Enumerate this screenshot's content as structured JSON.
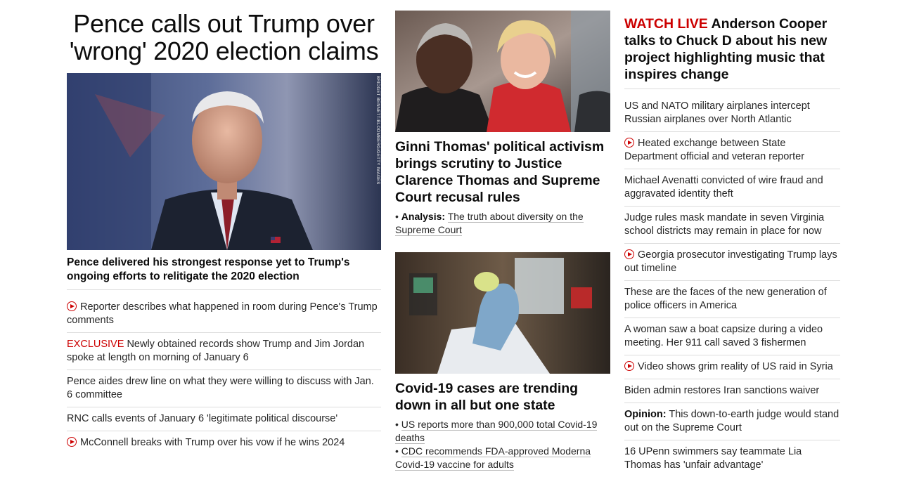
{
  "col1": {
    "hero_title": "Pence calls out Trump over 'wrong' 2020 election claims",
    "photo_credit": "BRIDGET BENNETT/BLOOMBERG/GETTY IMAGES",
    "lede": "Pence delivered his strongest response yet to Trump's ongoing efforts to relitigate the 2020 election",
    "items": [
      {
        "text": "Reporter describes what happened in room during Pence's Trump comments"
      },
      {
        "tag": "EXCLUSIVE",
        "text": "Newly obtained records show Trump and Jim Jordan spoke at length on morning of January 6"
      },
      {
        "text": "Pence aides drew line on what they were willing to discuss with Jan. 6 committee"
      },
      {
        "text": "RNC calls events of January 6 'legitimate political discourse'"
      },
      {
        "text": "McConnell breaks with Trump over his vow if he wins 2024"
      }
    ]
  },
  "col2": {
    "story1": {
      "title": "Ginni Thomas' political activism brings scrutiny to Justice Clarence Thomas and Supreme Court recusal rules",
      "sub_label": "Analysis:",
      "sub_text": "The truth about diversity on the Supreme Court"
    },
    "story2": {
      "title": "Covid-19 cases are trending down in all but one state",
      "subs": [
        "US reports more than 900,000 total Covid-19 deaths",
        "CDC recommends FDA-approved Moderna Covid-19 vaccine for adults"
      ]
    }
  },
  "col3": {
    "watch_label": "WATCH LIVE",
    "watch_text": "Anderson Cooper talks to Chuck D about his new project highlighting music that inspires change",
    "items": [
      {
        "text": "US and NATO military airplanes intercept Russian airplanes over North Atlantic"
      },
      {
        "text": "Heated exchange between State Department official and veteran reporter"
      },
      {
        "text": "Michael Avenatti convicted of wire fraud and aggravated identity theft"
      },
      {
        "text": "Judge rules mask mandate in seven Virginia school districts may remain in place for now"
      },
      {
        "text": "Georgia prosecutor investigating Trump lays out timeline"
      },
      {
        "text": "These are the faces of the new generation of police officers in America"
      },
      {
        "text": "A woman saw a boat capsize during a video meeting. Her 911 call saved 3 fishermen"
      },
      {
        "text": "Video shows grim reality of US raid in Syria"
      },
      {
        "text": "Biden admin restores Iran sanctions waiver"
      },
      {
        "label": "Opinion:",
        "text": "This down-to-earth judge would stand out on the Supreme Court"
      },
      {
        "text": "16 UPenn swimmers say teammate Lia Thomas has 'unfair advantage'"
      }
    ]
  },
  "icons": {
    "video": "play-circle-icon"
  },
  "colors": {
    "accent": "#cc0000",
    "divider": "#dcdcdc",
    "headline": "#0c0c0c"
  }
}
